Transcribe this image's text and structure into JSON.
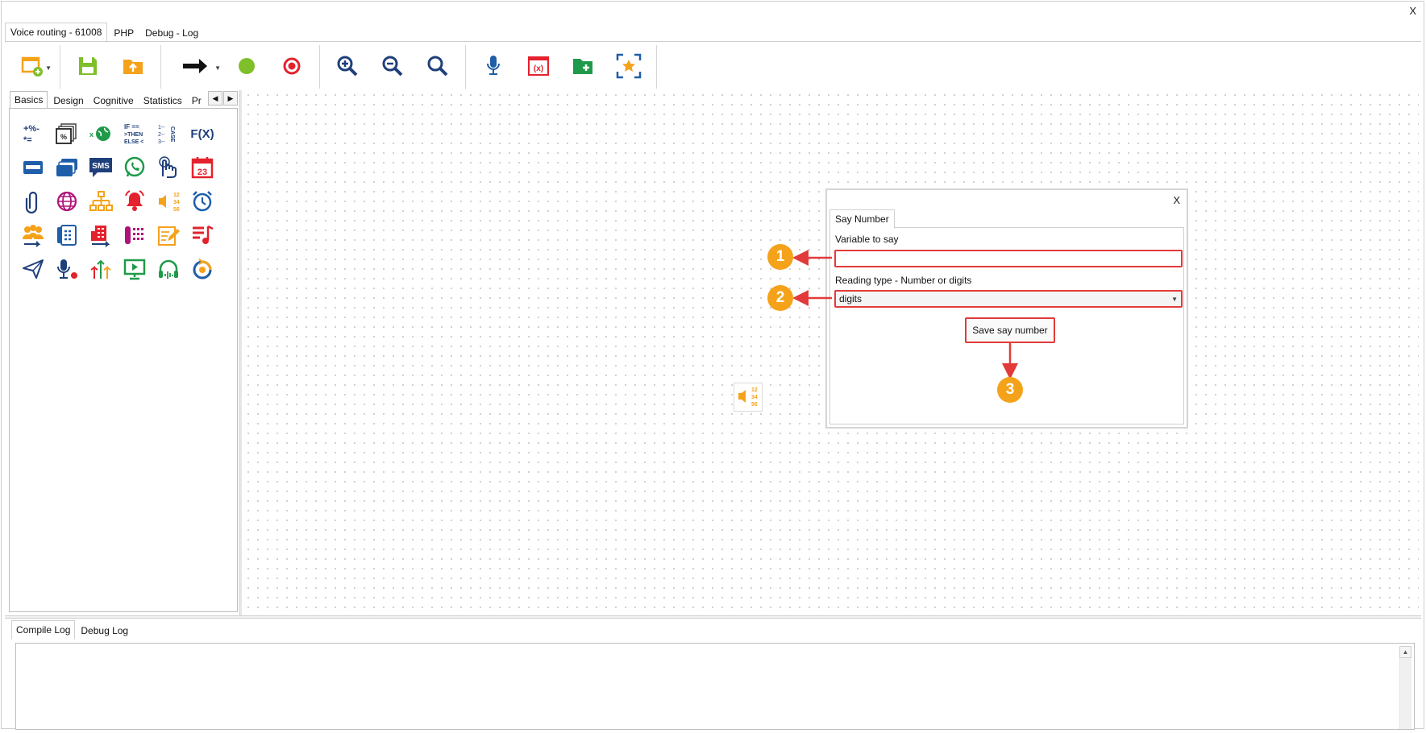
{
  "window": {
    "close_label": "X"
  },
  "top_tabs": [
    {
      "label": "Voice routing - 61008",
      "active": true
    },
    {
      "label": "PHP",
      "active": false
    },
    {
      "label": "Debug - Log",
      "active": false
    }
  ],
  "toolbar": {
    "buttons": [
      "new-icon",
      "save-icon",
      "upload-icon",
      "arrow-icon",
      "start-icon",
      "stop-icon",
      "zoom-in-icon",
      "zoom-out-icon",
      "zoom-fit-icon",
      "microphone-icon",
      "variables-icon",
      "add-folder-icon",
      "focus-star-icon"
    ],
    "colors": {
      "green": "#7fbf2a",
      "red": "#e3222d",
      "blue": "#1f5ea8",
      "orange": "#f5a21b"
    }
  },
  "palette": {
    "tabs": [
      "Basics",
      "Design",
      "Cognitive",
      "Statistics",
      "Pr"
    ],
    "fx_label": "F(X)",
    "sms_label": "SMS",
    "calendar_label": "23",
    "icons": [
      "math-icon",
      "percent-stack-icon",
      "globe-variable-icon",
      "if-then-else-icon",
      "case-icon",
      "function-icon",
      "card-icon",
      "cards-icon",
      "sms-icon",
      "whatsapp-icon",
      "dtmf-hand-icon",
      "calendar-icon",
      "attachment-icon",
      "web-icon",
      "hierarchy-icon",
      "alarm-bell-icon",
      "say-number-icon",
      "clock-icon",
      "queue-agents-icon",
      "phone-book-icon",
      "building-transfer-icon",
      "keypad-icon",
      "note-edit-icon",
      "music-list-icon",
      "send-icon",
      "record-mic-icon",
      "split-arrows-icon",
      "screen-play-icon",
      "headset-icon",
      "loop-icon"
    ]
  },
  "dialog": {
    "close_label": "X",
    "tab_label": "Say Number",
    "variable_label": "Variable to say",
    "variable_value": "",
    "reading_type_label": "Reading type - Number or digits",
    "reading_type_value": "digits",
    "save_label": "Save say number"
  },
  "callouts": [
    "1",
    "2",
    "3"
  ],
  "log": {
    "tabs": [
      {
        "label": "Compile Log",
        "active": true
      },
      {
        "label": "Debug Log",
        "active": false
      }
    ],
    "content": ""
  }
}
